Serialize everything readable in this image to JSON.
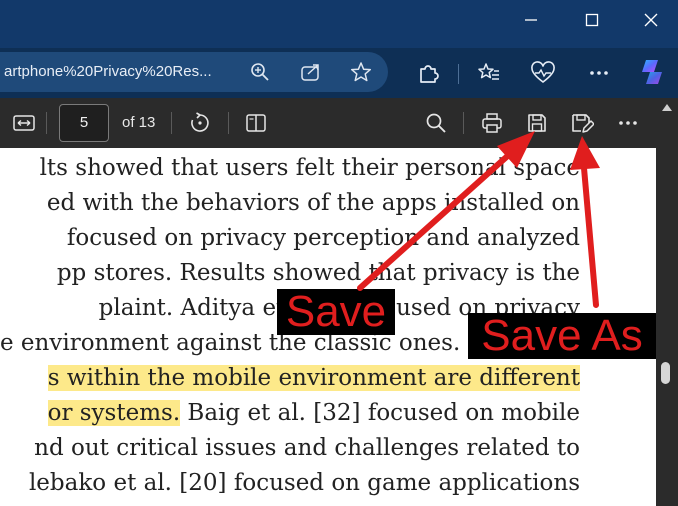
{
  "window": {
    "url": "artphone%20Privacy%20Res..."
  },
  "pdf_toolbar": {
    "page_number": "5",
    "page_total": "of 13"
  },
  "document": {
    "lines": [
      {
        "text": "lts showed that users felt their personal space"
      },
      {
        "text": "ed with the behaviors of the apps installed on"
      },
      {
        "text": "focused on privacy perception and analyzed"
      },
      {
        "text": "pp stores. Results showed that privacy is the"
      },
      {
        "text": "plaint. Aditya et al. [  ] focused on privacy"
      },
      {
        "text": "e environment against the classic ones."
      },
      {
        "highlight": "s within the mobile environment are different"
      },
      {
        "highlight": "or systems.",
        "text": " Baig et al. [32] focused on mobile"
      },
      {
        "text": "nd out critical issues and challenges related to"
      },
      {
        "text": "lebako et al. [20] focused on game applications"
      }
    ]
  },
  "annotations": {
    "save_label": "Save",
    "save_as_label": "Save As",
    "arrow_color": "#e01e1e"
  }
}
